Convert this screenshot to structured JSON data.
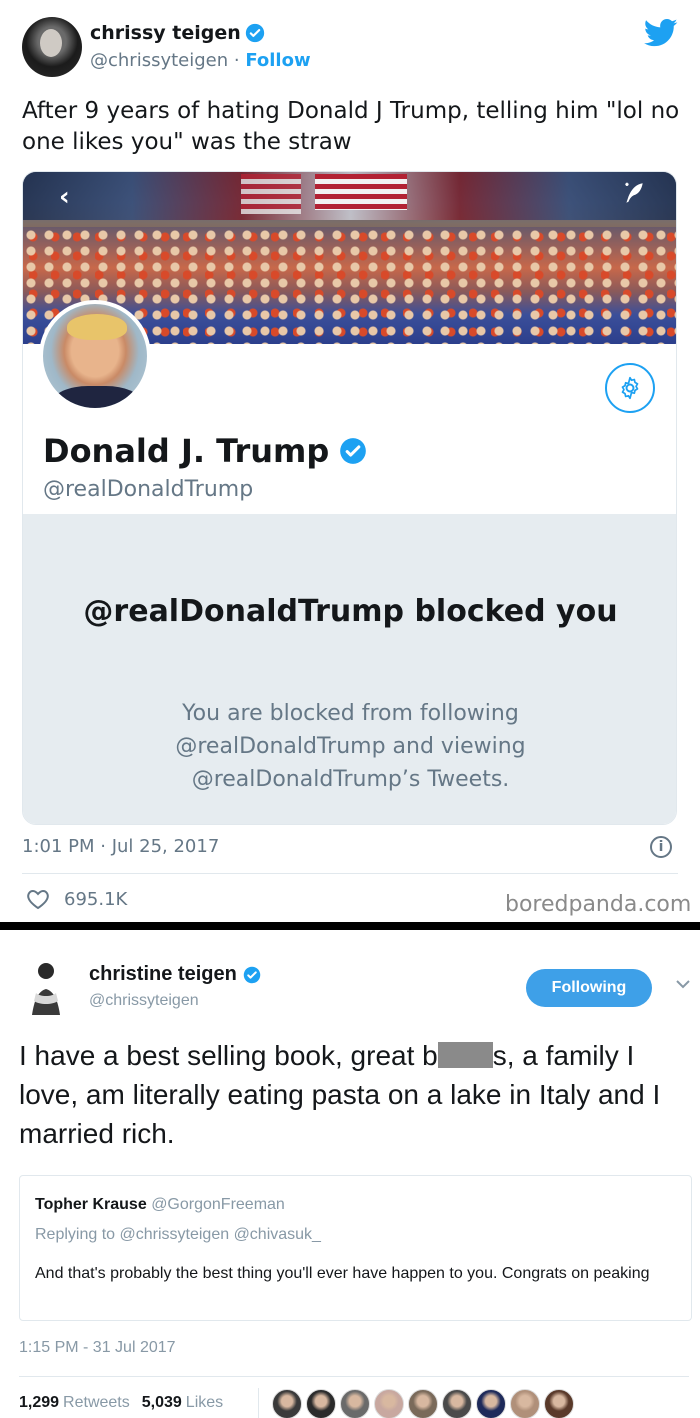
{
  "tweet1": {
    "author_name": "chrissy teigen",
    "author_handle": "@chrissyteigen",
    "dot": " · ",
    "follow_label": "Follow",
    "text": "After 9 years of hating Donald J Trump, telling him \"lol no one likes you\" was the straw",
    "timestamp": "1:01 PM · Jul 25, 2017",
    "info_label": "i",
    "likes": "695.1K",
    "watermark": "boredpanda.com",
    "icons": [
      "verified-badge-icon",
      "twitter-bird-icon",
      "heart-icon",
      "info-icon"
    ]
  },
  "profile_card": {
    "name": "Donald J. Trump",
    "handle": "@realDonaldTrump",
    "back_glyph": "‹",
    "blocked_title": "@realDonaldTrump blocked you",
    "blocked_line1": "You are blocked from following",
    "blocked_line2": "@realDonaldTrump and viewing",
    "blocked_line3": "@realDonaldTrump’s Tweets.",
    "icons": [
      "back-arrow-icon",
      "compose-quill-icon",
      "settings-gear-icon",
      "verified-badge-icon"
    ]
  },
  "tweet2": {
    "author_name": "christine teigen",
    "author_handle": "@chrissyteigen",
    "following_label": "Following",
    "text_part1": "I have a best selling book, great b",
    "text_part2": "s, a family I love, am literally eating pasta on a lake in Italy and I married rich.",
    "quote": {
      "name": "Topher Krause",
      "handle": "@GorgonFreeman",
      "reply_prefix": "Replying to ",
      "reply_to": "@chrissyteigen @chivasuk_",
      "text": "And that's probably the best thing you'll ever have happen to you. Congrats on peaking"
    },
    "timestamp": "1:15 PM - 31 Jul 2017",
    "retweets_count": "1,299",
    "retweets_label": "Retweets",
    "likes_count": "5,039",
    "likes_label": "Likes",
    "liker_avatar_colors": [
      "#3a3a3a",
      "#2b2b2b",
      "#6a6a6a",
      "#c8a8a0",
      "#7a6a5a",
      "#4a4a4a",
      "#1e2a5a",
      "#b0907a",
      "#5a3a2a"
    ]
  },
  "colors": {
    "twitter_blue": "#1da1f2",
    "following_blue": "#3ea0e8",
    "muted_gray": "#657786",
    "blocked_panel": "#e6ecf0"
  }
}
